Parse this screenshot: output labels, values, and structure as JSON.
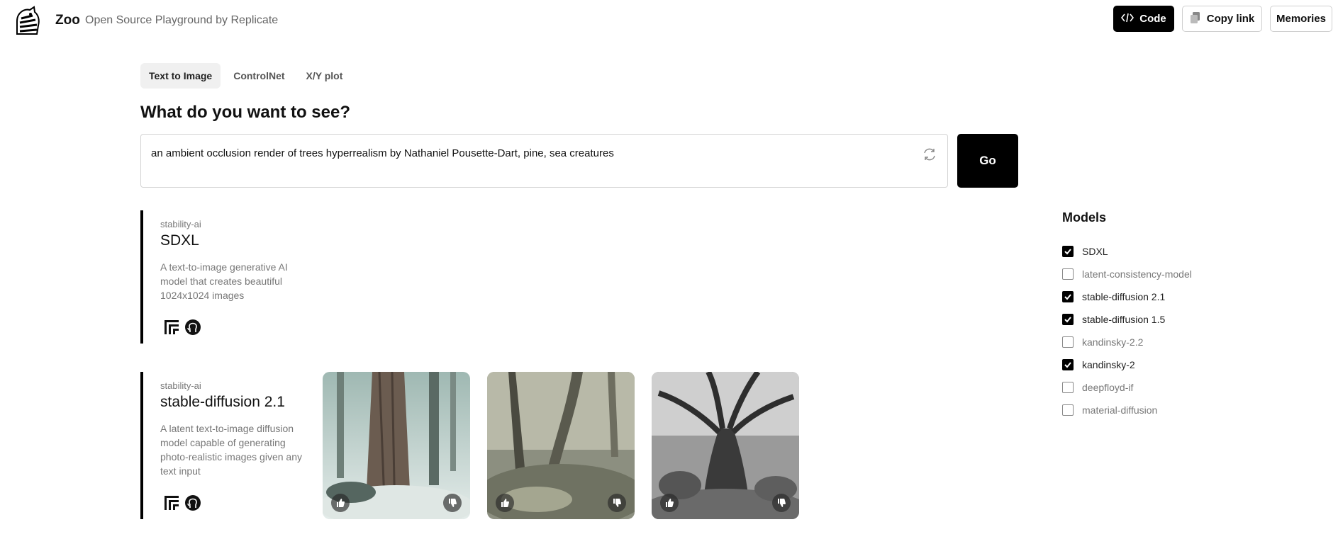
{
  "header": {
    "brand": "Zoo",
    "subtitle": "Open Source Playground by Replicate",
    "code_label": "Code",
    "copy_label": "Copy link",
    "memories_label": "Memories"
  },
  "tabs": [
    {
      "label": "Text to Image",
      "active": true
    },
    {
      "label": "ControlNet",
      "active": false
    },
    {
      "label": "X/Y plot",
      "active": false
    }
  ],
  "question": "What do you want to see?",
  "prompt": {
    "value": "an ambient occlusion render of trees hyperrealism by Nathaniel Pousette-Dart, pine, sea creatures",
    "go_label": "Go"
  },
  "cards": [
    {
      "owner": "stability-ai",
      "name": "SDXL",
      "description": "A text-to-image generative AI model that creates beautiful 1024x1024 images"
    },
    {
      "owner": "stability-ai",
      "name": "stable-diffusion 2.1",
      "description": "A latent text-to-image diffusion model capable of generating photo-realistic images given any text input"
    }
  ],
  "models": {
    "title": "Models",
    "items": [
      {
        "label": "SDXL",
        "checked": true
      },
      {
        "label": "latent-consistency-model",
        "checked": false
      },
      {
        "label": "stable-diffusion 2.1",
        "checked": true
      },
      {
        "label": "stable-diffusion 1.5",
        "checked": true
      },
      {
        "label": "kandinsky-2.2",
        "checked": false
      },
      {
        "label": "kandinsky-2",
        "checked": true
      },
      {
        "label": "deepfloyd-if",
        "checked": false
      },
      {
        "label": "material-diffusion",
        "checked": false
      }
    ]
  },
  "colors": {
    "accent": "#000000",
    "muted_text": "#777777"
  }
}
